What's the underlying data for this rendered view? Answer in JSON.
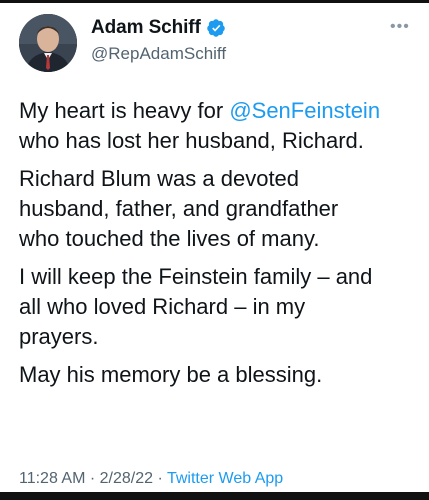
{
  "author": {
    "name": "Adam Schiff",
    "handle": "@RepAdamSchiff",
    "verified": true
  },
  "menu": {
    "more_label": "•••"
  },
  "tweet": {
    "para1_pre": "My heart is heavy for ",
    "mention": "@SenFeinstein",
    "para1_post": "who has lost her husband, Richard.",
    "para2": "Richard Blum was a devoted\nhusband, father, and grandfather\nwho touched the lives of many.",
    "para3": "I will keep the Feinstein family – and\nall who loved Richard – in my\nprayers.",
    "para4": "May his memory be a blessing."
  },
  "meta": {
    "time": "11:28 AM",
    "sep1": " · ",
    "date": "2/28/22",
    "sep2": " · ",
    "app": "Twitter Web App"
  },
  "colors": {
    "link": "#1d9bf0",
    "secondary_text": "#536471",
    "verified_badge": "#1d9bf0"
  }
}
